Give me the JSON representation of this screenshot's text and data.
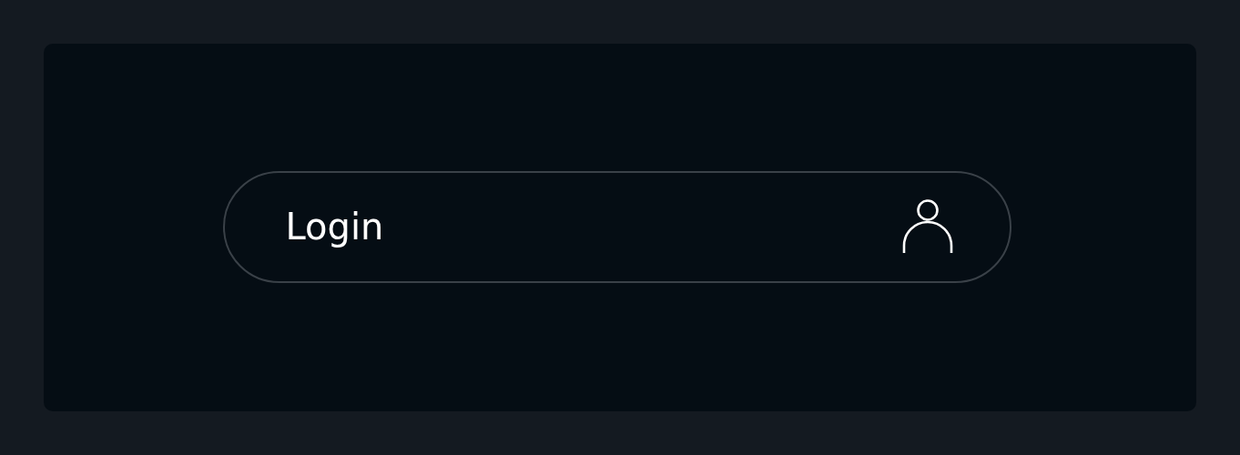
{
  "login_button": {
    "label": "Login"
  }
}
